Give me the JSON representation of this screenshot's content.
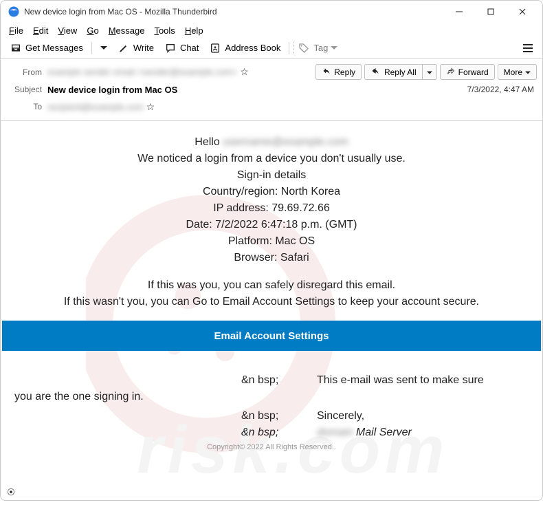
{
  "window": {
    "title": "New device login from Mac OS - Mozilla Thunderbird"
  },
  "menubar": [
    {
      "full": "File",
      "ul": "F",
      "rest": "ile"
    },
    {
      "full": "Edit",
      "ul": "E",
      "rest": "dit"
    },
    {
      "full": "View",
      "ul": "V",
      "rest": "iew"
    },
    {
      "full": "Go",
      "ul": "G",
      "rest": "o"
    },
    {
      "full": "Message",
      "ul": "M",
      "rest": "essage"
    },
    {
      "full": "Tools",
      "ul": "T",
      "rest": "ools"
    },
    {
      "full": "Help",
      "ul": "H",
      "rest": "elp"
    }
  ],
  "toolbar": {
    "get_messages": "Get Messages",
    "write": "Write",
    "chat": "Chat",
    "address_book": "Address Book",
    "tag": "Tag"
  },
  "headers": {
    "from_label": "From",
    "from_value": "",
    "subject_label": "Subject",
    "subject_value": "New device login from Mac OS",
    "to_label": "To",
    "to_value": "",
    "received": "7/3/2022, 4:47 AM"
  },
  "actions": {
    "reply": "Reply",
    "reply_all": "Reply All",
    "forward": "Forward",
    "more": "More"
  },
  "body": {
    "hello": "Hello ",
    "hello_name_placeholder": "",
    "notice": "We noticed a login from a device you don't usually use.",
    "signin_title": "Sign-in details",
    "country_line": "Country/region: North Korea",
    "ip_line": "IP address: 79.69.72.66",
    "date_line": "Date: 7/2/2022 6:47:18 p.m. (GMT)",
    "platform_line": "Platform: Mac OS",
    "browser_line": "Browser: Safari",
    "disregard": "If this was you, you can safely disregard this email.",
    "secure": "If this wasn't you, you can Go to Email Account Settings to keep your account secure.",
    "cta": "Email Account Settings",
    "nbsp": "&n bsp;",
    "sent_sure": "This e-mail was sent to make sure",
    "you_signing_in": "you are the one signing in.",
    "sincerely": "Sincerely,",
    "mail_server_prefix": "",
    "mail_server_suffix": " Mail Server",
    "copyright": "Copyright© 2022 All Rights Reserved.."
  }
}
